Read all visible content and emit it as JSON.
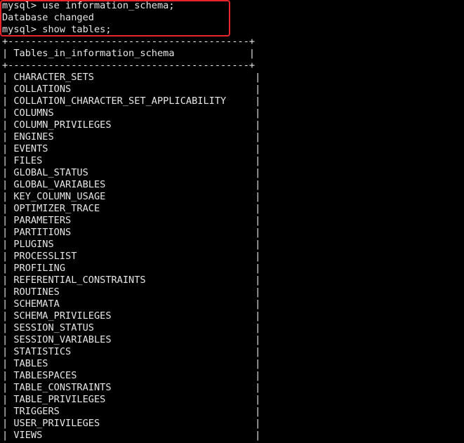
{
  "terminal": {
    "commands": {
      "use_command": "mysql> use information_schema;",
      "db_changed": "Database changed",
      "show_command": "mysql> show tables;"
    },
    "table": {
      "border_line": "+------------------------------------------+",
      "header": "| Tables_in_information_schema             |",
      "rows": [
        "| CHARACTER_SETS                            |",
        "| COLLATIONS                                |",
        "| COLLATION_CHARACTER_SET_APPLICABILITY     |",
        "| COLUMNS                                   |",
        "| COLUMN_PRIVILEGES                         |",
        "| ENGINES                                   |",
        "| EVENTS                                    |",
        "| FILES                                     |",
        "| GLOBAL_STATUS                             |",
        "| GLOBAL_VARIABLES                          |",
        "| KEY_COLUMN_USAGE                          |",
        "| OPTIMIZER_TRACE                           |",
        "| PARAMETERS                                |",
        "| PARTITIONS                                |",
        "| PLUGINS                                   |",
        "| PROCESSLIST                               |",
        "| PROFILING                                 |",
        "| REFERENTIAL_CONSTRAINTS                   |",
        "| ROUTINES                                  |",
        "| SCHEMATA                                  |",
        "| SCHEMA_PRIVILEGES                         |",
        "| SESSION_STATUS                            |",
        "| SESSION_VARIABLES                         |",
        "| STATISTICS                                |",
        "| TABLES                                    |",
        "| TABLESPACES                               |",
        "| TABLE_CONSTRAINTS                         |",
        "| TABLE_PRIVILEGES                          |",
        "| TRIGGERS                                  |",
        "| USER_PRIVILEGES                           |",
        "| VIEWS                                     |"
      ]
    },
    "colors": {
      "background": "#000000",
      "text": "#e6e6e6",
      "highlight": "#e8262a"
    }
  }
}
